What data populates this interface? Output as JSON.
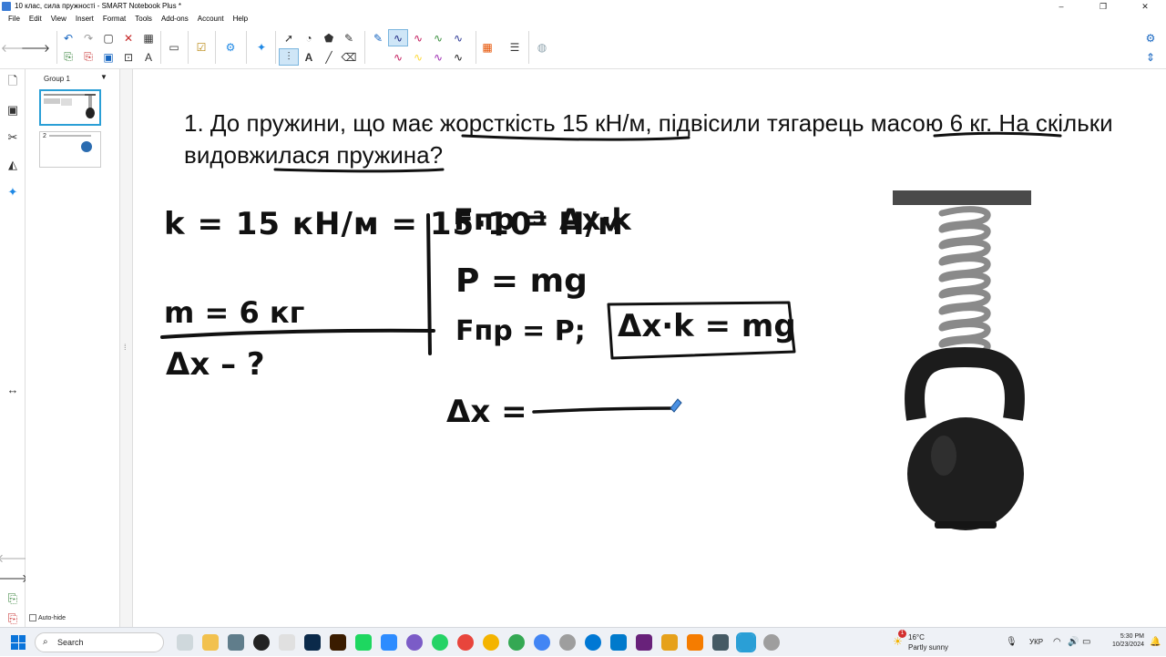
{
  "window": {
    "title": "10 клас, сила пружності - SMART Notebook Plus *",
    "controls": [
      "–",
      "❐",
      "✕"
    ]
  },
  "menu": [
    "File",
    "Edit",
    "View",
    "Insert",
    "Format",
    "Tools",
    "Add-ons",
    "Account",
    "Help"
  ],
  "sidebar": {
    "group_label": "Group 1",
    "page2_num": "2",
    "autohide_label": "Auto-hide"
  },
  "slide": {
    "question_parts": [
      "1. До пружини, що має ",
      "жорсткість 15 кН/м",
      ", підвісили тягарець ",
      "масою 6 кг",
      ". На скільки ",
      "видовжилася",
      " пружина?"
    ],
    "handwriting": {
      "k_line": "k = 15 кН/м = 15·10³ Н/м",
      "m_line": "m = 6 кг",
      "dx_q": "Δx – ?",
      "f1": "Fпр = Δx·k",
      "f2": "P = mg",
      "f3": "Fпр = P;",
      "boxed": "Δx·k = mg",
      "dx_eq": "Δx ="
    }
  },
  "taskbar": {
    "search_placeholder": "Search",
    "weather_temp": "16°C",
    "weather_desc": "Partly sunny",
    "lang": "УКР",
    "time": "5:30 PM",
    "date": "10/23/2024",
    "weather_badge": "1"
  },
  "colors": {
    "accent": "#2a9fd6",
    "ink": "#111111",
    "pen_blue": "#2980ff",
    "taskbar_bg": "#eef1f6"
  }
}
